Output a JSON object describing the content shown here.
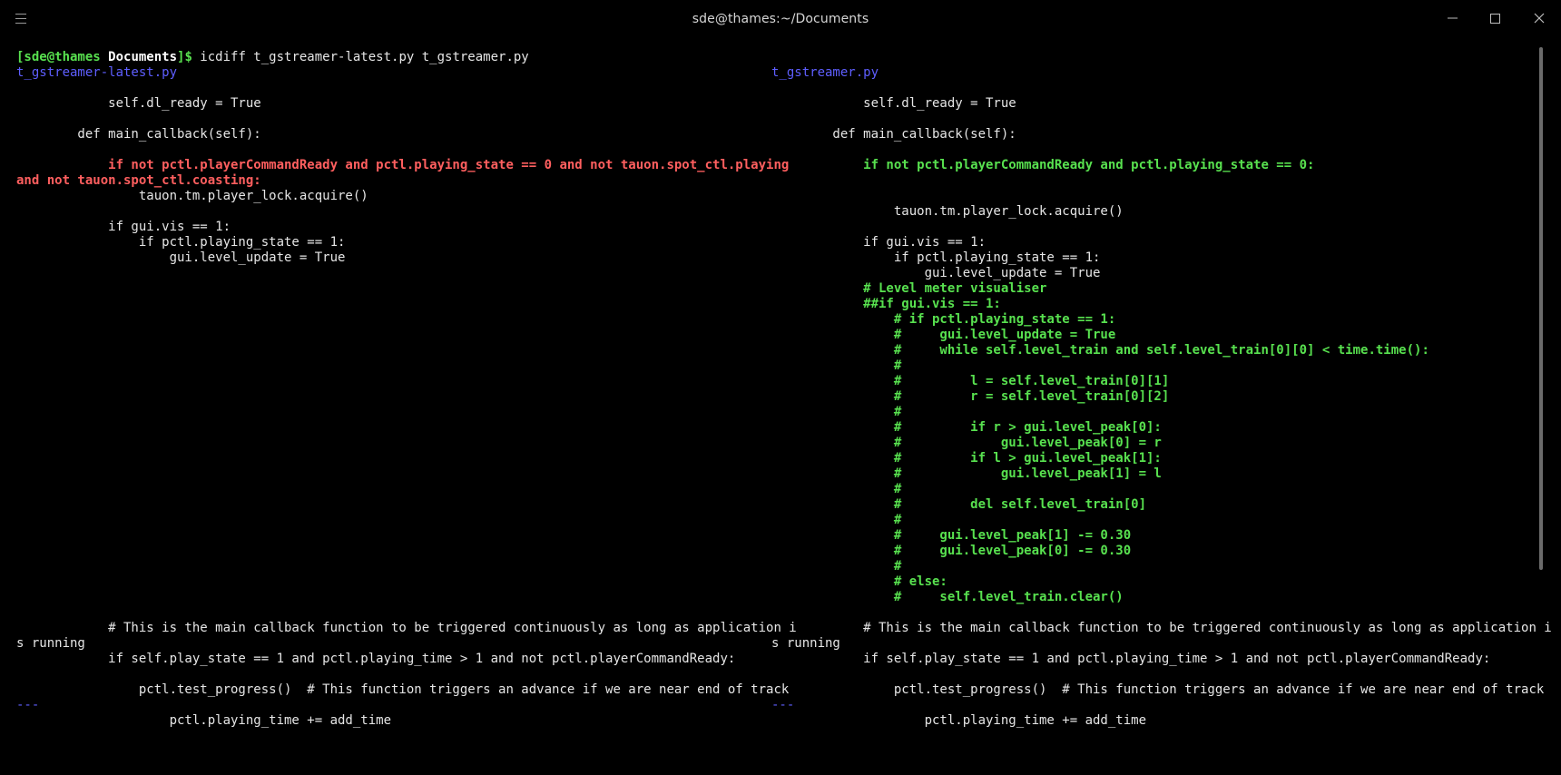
{
  "window": {
    "title": "sde@thames:~/Documents",
    "menu_icon": "hamburger-menu-icon",
    "minimize_icon": "minimize-icon",
    "maximize_icon": "maximize-icon",
    "close_icon": "close-icon"
  },
  "terminal": {
    "prompt": {
      "user_host": "[sde@thames",
      "cwd": "Documents",
      "suffix": "]$",
      "command": " icdiff t_gstreamer-latest.py t_gstreamer.py"
    },
    "left_file": "t_gstreamer-latest.py",
    "right_file": "t_gstreamer.py",
    "lines": {
      "l_dl_ready": "            self.dl_ready = True",
      "l_def": "        def main_callback(self):",
      "l_if_red_a": "            if not pctl.playerCommandReady and pctl.playing_state == 0 and not tauon.spot_ctl.playing",
      "l_if_red_b": "and not tauon.spot_ctl.coasting:",
      "l_lock": "                tauon.tm.player_lock.acquire()",
      "l_vis": "            if gui.vis == 1:",
      "l_state": "                if pctl.playing_state == 1:",
      "l_level": "                    gui.level_update = True",
      "l_comment_a": "            # This is the main callback function to be triggered continuously as long as application i",
      "l_comment_b": "s running",
      "l_if_play": "            if self.play_state == 1 and pctl.playing_time > 1 and not pctl.playerCommandReady:",
      "l_progress": "                pctl.test_progress()  # This function triggers an advance if we are near end of track",
      "l_sep": "---",
      "l_time": "                    pctl.playing_time += add_time",
      "r_dl_ready": "            self.dl_ready = True",
      "r_def": "        def main_callback(self):",
      "r_if_green": "            if not pctl.playerCommandReady and pctl.playing_state == 0:",
      "r_lock": "                tauon.tm.player_lock.acquire()",
      "r_vis": "            if gui.vis == 1:",
      "r_state": "                if pctl.playing_state == 1:",
      "r_level": "                    gui.level_update = True",
      "r_g1": "            # Level meter visualiser",
      "r_g2": "            ##if gui.vis == 1:",
      "r_g3": "                # if pctl.playing_state == 1:",
      "r_g4": "                #     gui.level_update = True",
      "r_g5": "                #     while self.level_train and self.level_train[0][0] < time.time():",
      "r_g6": "                #",
      "r_g7": "                #         l = self.level_train[0][1]",
      "r_g8": "                #         r = self.level_train[0][2]",
      "r_g9": "                #",
      "r_g10": "                #         if r > gui.level_peak[0]:",
      "r_g11": "                #             gui.level_peak[0] = r",
      "r_g12": "                #         if l > gui.level_peak[1]:",
      "r_g13": "                #             gui.level_peak[1] = l",
      "r_g14": "                #",
      "r_g15": "                #         del self.level_train[0]",
      "r_g16": "                #",
      "r_g17": "                #     gui.level_peak[1] -= 0.30",
      "r_g18": "                #     gui.level_peak[0] -= 0.30",
      "r_g19": "                #",
      "r_g20": "                # else:",
      "r_g21": "                #     self.level_train.clear()",
      "r_comment_a": "            # This is the main callback function to be triggered continuously as long as application i",
      "r_comment_b": "s running",
      "r_if_play": "            if self.play_state == 1 and pctl.playing_time > 1 and not pctl.playerCommandReady:",
      "r_progress": "                pctl.test_progress()  # This function triggers an advance if we are near end of track",
      "r_sep": "---",
      "r_time": "                    pctl.playing_time += add_time"
    }
  },
  "colors": {
    "background": "#000000",
    "added": "#58e14f",
    "removed": "#ff5f5f",
    "filename": "#5e5eff",
    "text": "#e6e6e6"
  }
}
